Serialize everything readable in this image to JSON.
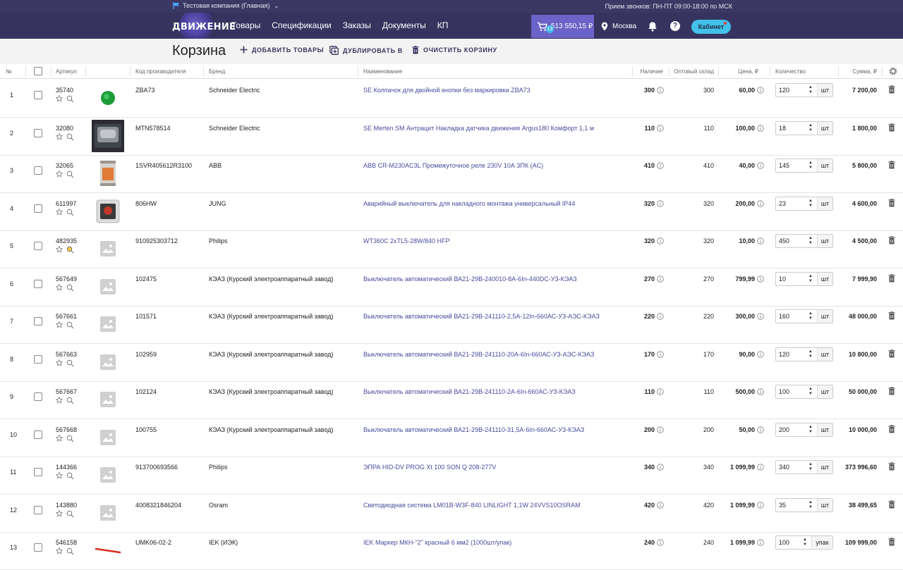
{
  "topbar": {
    "company": "Тестовая компания (Главная)",
    "hours": "Прием звонков: ПН-ПТ 09:00-18:00 по МСК"
  },
  "nav": {
    "logo": "ДВИЖЕНИЕ",
    "links": [
      "Товары",
      "Спецификации",
      "Заказы",
      "Документы",
      "КП"
    ],
    "cart_total": "513 550,15 ₽",
    "cart_count": "13",
    "city": "Москва",
    "cabinet": "Кабинет"
  },
  "actions": {
    "title": "Корзина",
    "add": "ДОБАВИТЬ ТОВАРЫ",
    "duplicate": "ДУБЛИРОВАТЬ В",
    "clear": "ОЧИСТИТЬ КОРЗИНУ"
  },
  "headers": {
    "num": "№",
    "article": "Артикул",
    "maker_code": "Код производителя",
    "brand": "Бренд",
    "name": "Наименование",
    "stock": "Наличие",
    "wholesale": "Оптовый склад",
    "price": "Цена, ₽",
    "qty": "Количество",
    "sum": "Сумма, ₽"
  },
  "rows": [
    {
      "num": "1",
      "article": "35740",
      "img": "green-button",
      "code": "ZBA73",
      "brand": "Schneider Electric",
      "name": "SE Колпачок для двойной кнопки без маркировки ZBA73",
      "stock": "300",
      "wholesale": "300",
      "price": "60,00",
      "qty": "120",
      "unit": "шт",
      "sum": "7 200,00"
    },
    {
      "num": "2",
      "article": "32080",
      "img": "motion-sensor",
      "code": "MTN578514",
      "brand": "Schneider Electric",
      "name": "SE Merten SM Антрацит Накладка датчика движения Argus180 Комфорт 1,1 м",
      "stock": "110",
      "wholesale": "110",
      "price": "100,00",
      "qty": "18",
      "unit": "шт",
      "sum": "1 800,00"
    },
    {
      "num": "3",
      "article": "32065",
      "img": "relay",
      "code": "1SVR405612R3100",
      "brand": "ABB",
      "name": "ABB CR-M230AC3L Промежуточное реле 230V 10А 3ПК (AC)",
      "stock": "410",
      "wholesale": "410",
      "price": "40,00",
      "qty": "145",
      "unit": "шт",
      "sum": "5 800,00"
    },
    {
      "num": "4",
      "article": "611997",
      "img": "emergency-switch",
      "code": "806HW",
      "brand": "JUNG",
      "name": "Аварийный выключатель для накладного монтажа универсальный IP44",
      "stock": "320",
      "wholesale": "320",
      "price": "200,00",
      "qty": "23",
      "unit": "шт",
      "sum": "4 600,00"
    },
    {
      "num": "5",
      "article": "482935",
      "img": "placeholder",
      "code": "910925303712",
      "brand": "Philips",
      "name": "WT360C 2xTL5-28W/840 HFP",
      "stock": "320",
      "wholesale": "320",
      "price": "10,00",
      "qty": "450",
      "unit": "шт",
      "sum": "4 500,00"
    },
    {
      "num": "6",
      "article": "567649",
      "img": "placeholder",
      "code": "102475",
      "brand": "КЭАЗ (Курский электроаппаратный завод)",
      "name": "Выключатель автоматический ВА21-29В-240010-8А-6In-440DC-УЗ-КЭАЗ",
      "stock": "270",
      "wholesale": "270",
      "price": "799,99",
      "qty": "10",
      "unit": "шт",
      "sum": "7 999,90"
    },
    {
      "num": "7",
      "article": "567661",
      "img": "placeholder",
      "code": "101571",
      "brand": "КЭАЗ (Курский электроаппаратный завод)",
      "name": "Выключатель автоматический ВА21-29В-241110-2,5А-12In-660АС-УЗ-АЭС-КЭАЗ",
      "stock": "220",
      "wholesale": "220",
      "price": "300,00",
      "qty": "160",
      "unit": "шт",
      "sum": "48 000,00"
    },
    {
      "num": "8",
      "article": "567663",
      "img": "placeholder",
      "code": "102959",
      "brand": "КЭАЗ (Курский электроаппаратный завод)",
      "name": "Выключатель автоматический ВА21-29В-241110-20А-6In-660АС-УЗ-АЭС-КЭАЗ",
      "stock": "170",
      "wholesale": "170",
      "price": "90,00",
      "qty": "120",
      "unit": "шт",
      "sum": "10 800,00"
    },
    {
      "num": "9",
      "article": "567667",
      "img": "placeholder",
      "code": "102124",
      "brand": "КЭАЗ (Курский электроаппаратный завод)",
      "name": "Выключатель автоматический ВА21-29В-241110-2А-6In-660АС-УЗ-КЭАЗ",
      "stock": "110",
      "wholesale": "110",
      "price": "500,00",
      "qty": "100",
      "unit": "шт",
      "sum": "50 000,00"
    },
    {
      "num": "10",
      "article": "567668",
      "img": "placeholder",
      "code": "100755",
      "brand": "КЭАЗ (Курский электроаппаратный завод)",
      "name": "Выключатель автоматический ВА21-29В-241110-31,5А-6In-660АС-УЗ-КЭАЗ",
      "stock": "200",
      "wholesale": "200",
      "price": "50,00",
      "qty": "200",
      "unit": "шт",
      "sum": "10 000,00"
    },
    {
      "num": "11",
      "article": "144366",
      "img": "placeholder",
      "code": "913700693566",
      "brand": "Philips",
      "name": "ЭПРА HID-DV PROG Xt 100 SON Q 208-277V",
      "stock": "340",
      "wholesale": "340",
      "price": "1 099,99",
      "qty": "340",
      "unit": "шт",
      "sum": "373 996,60"
    },
    {
      "num": "12",
      "article": "143880",
      "img": "placeholder",
      "code": "4008321846204",
      "brand": "Osram",
      "name": "Светодиодная система LM01B-W3F-840 LINLIGHT 1,1W 24VVS10OSRAM",
      "stock": "420",
      "wholesale": "420",
      "price": "1 099,99",
      "qty": "35",
      "unit": "шт",
      "sum": "38 499,65"
    },
    {
      "num": "13",
      "article": "546158",
      "img": "red-marker",
      "code": "UMK06-02-2",
      "brand": "IEK (ИЭК)",
      "name": "IEK Маркер МКН-\"2\" красный 6 мм2 (1000шт/упак)",
      "stock": "240",
      "wholesale": "240",
      "price": "1 099,99",
      "qty": "100",
      "unit": "упак",
      "sum": "109 999,00"
    }
  ]
}
